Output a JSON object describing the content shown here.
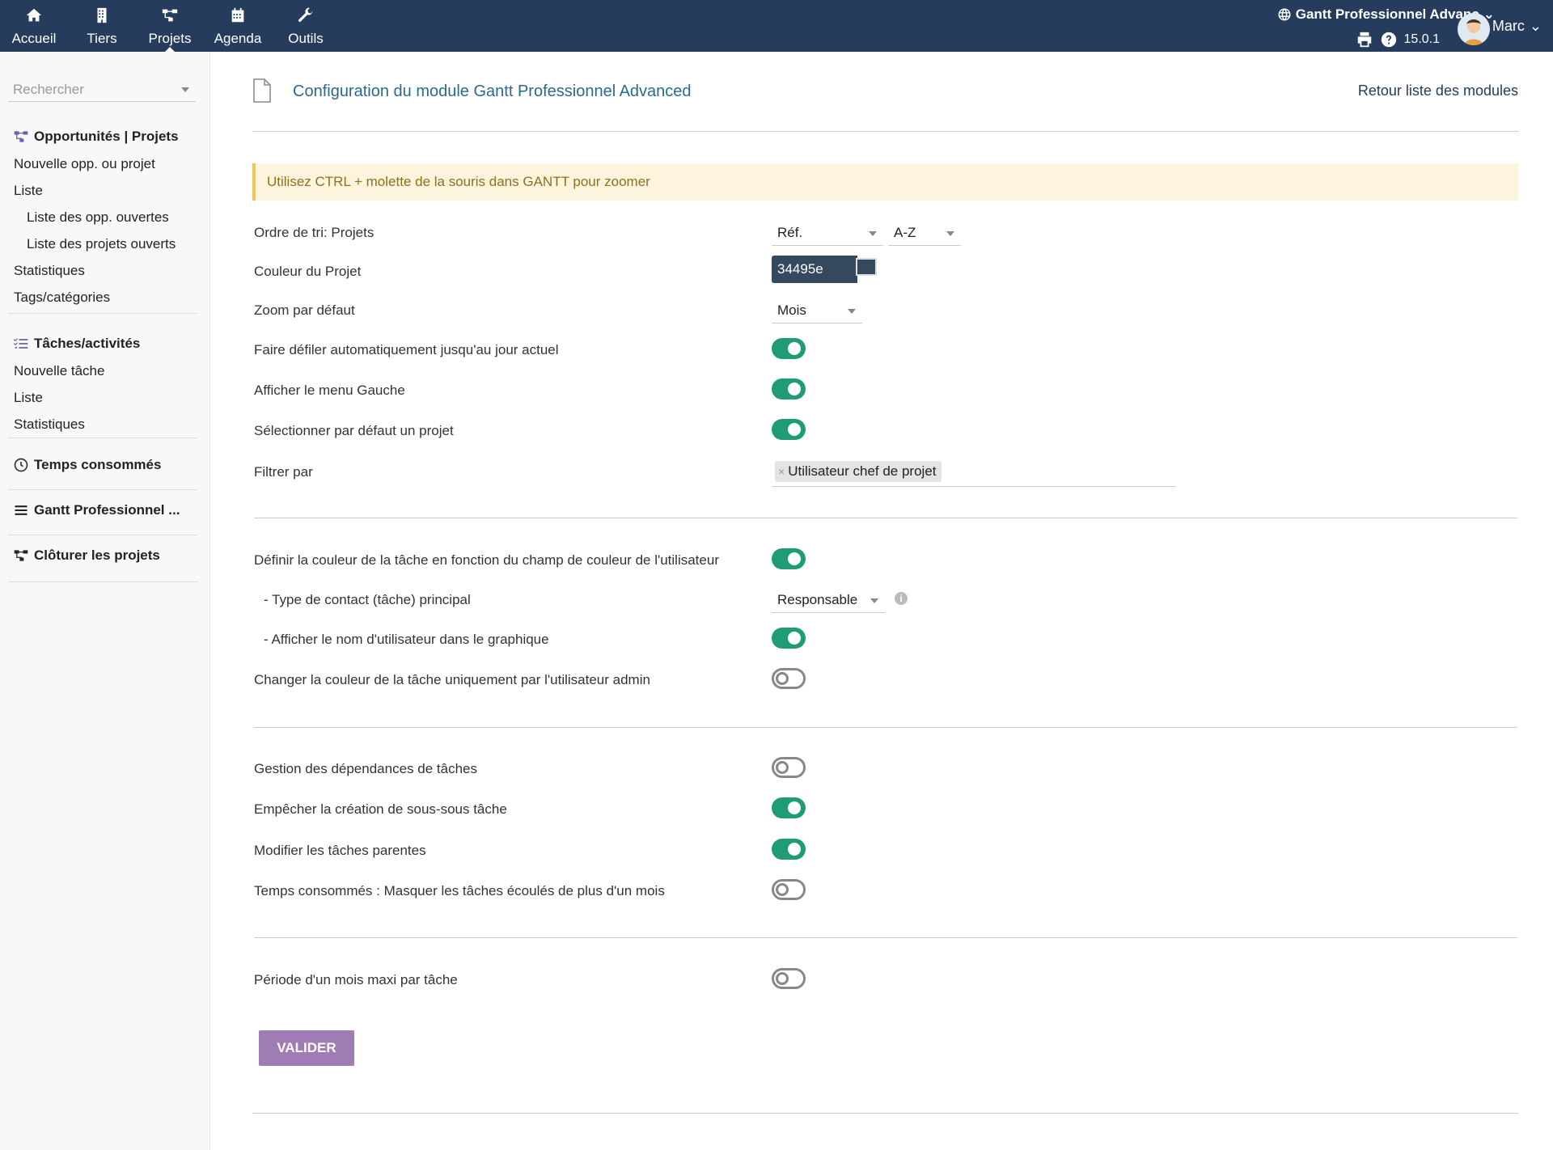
{
  "topnav": {
    "items": [
      {
        "label": "Accueil",
        "icon": "home-icon"
      },
      {
        "label": "Tiers",
        "icon": "building-icon"
      },
      {
        "label": "Projets",
        "icon": "project-icon"
      },
      {
        "label": "Agenda",
        "icon": "calendar-icon"
      },
      {
        "label": "Outils",
        "icon": "wrench-icon"
      }
    ],
    "module_name": "Gantt Professionnel Advanc",
    "version": "15.0.1",
    "user": "Marc"
  },
  "sidebar": {
    "search_placeholder": "Rechercher",
    "sections": [
      {
        "title": "Opportunités | Projets",
        "links": [
          "Nouvelle opp. ou projet",
          "Liste",
          "Liste des opp. ouvertes",
          "Liste des projets ouverts",
          "Statistiques",
          "Tags/catégories"
        ]
      },
      {
        "title": "Tâches/activités",
        "links": [
          "Nouvelle tâche",
          "Liste",
          "Statistiques"
        ]
      },
      {
        "title": "Temps consommés",
        "links": []
      },
      {
        "title": "Gantt Professionnel ...",
        "links": []
      },
      {
        "title": "Clôturer les projets",
        "links": []
      }
    ]
  },
  "page": {
    "title": "Configuration du module Gantt Professionnel Advanced",
    "back_link": "Retour liste des modules",
    "notice": "Utilisez CTRL + molette de la souris dans GANTT pour zoomer"
  },
  "settings": {
    "sort_label": "Ordre de tri: Projets",
    "sort_field": "Réf.",
    "sort_dir": "A-Z",
    "color_label": "Couleur du Projet",
    "color_value": "34495e",
    "zoom_label": "Zoom par défaut",
    "zoom_value": "Mois",
    "autoscroll_label": "Faire défiler automatiquement jusqu'au jour actuel",
    "left_menu_label": "Afficher le menu Gauche",
    "select_project_label": "Sélectionner par défaut un projet",
    "filter_label": "Filtrer par",
    "filter_tag": "Utilisateur chef de projet",
    "task_color_label": "Définir la couleur de la tâche en fonction du champ de couleur de l'utilisateur",
    "contact_type_label": "- Type de contact (tâche) principal",
    "contact_type_value": "Responsable",
    "show_username_label": "- Afficher le nom d'utilisateur dans le graphique",
    "admin_color_label": "Changer la couleur de la tâche uniquement par l'utilisateur admin",
    "dependencies_label": "Gestion des dépendances de tâches",
    "prevent_subsub_label": "Empêcher la création de sous-sous tâche",
    "modify_parents_label": "Modifier les tâches parentes",
    "hide_old_label": "Temps consommés : Masquer les tâches écoulés de plus d'un mois",
    "max_period_label": "Période d'un mois maxi par tâche",
    "toggles": {
      "autoscroll": true,
      "left_menu": true,
      "select_project": true,
      "task_color": true,
      "show_username": true,
      "admin_color": false,
      "dependencies": false,
      "prevent_subsub": true,
      "modify_parents": true,
      "hide_old": false,
      "max_period": false
    },
    "submit_label": "VALIDER"
  },
  "colors": {
    "topbar": "#263c5c",
    "toggle_on": "#1f9b75",
    "button": "#a07cb4",
    "project_color": "#34495e"
  }
}
